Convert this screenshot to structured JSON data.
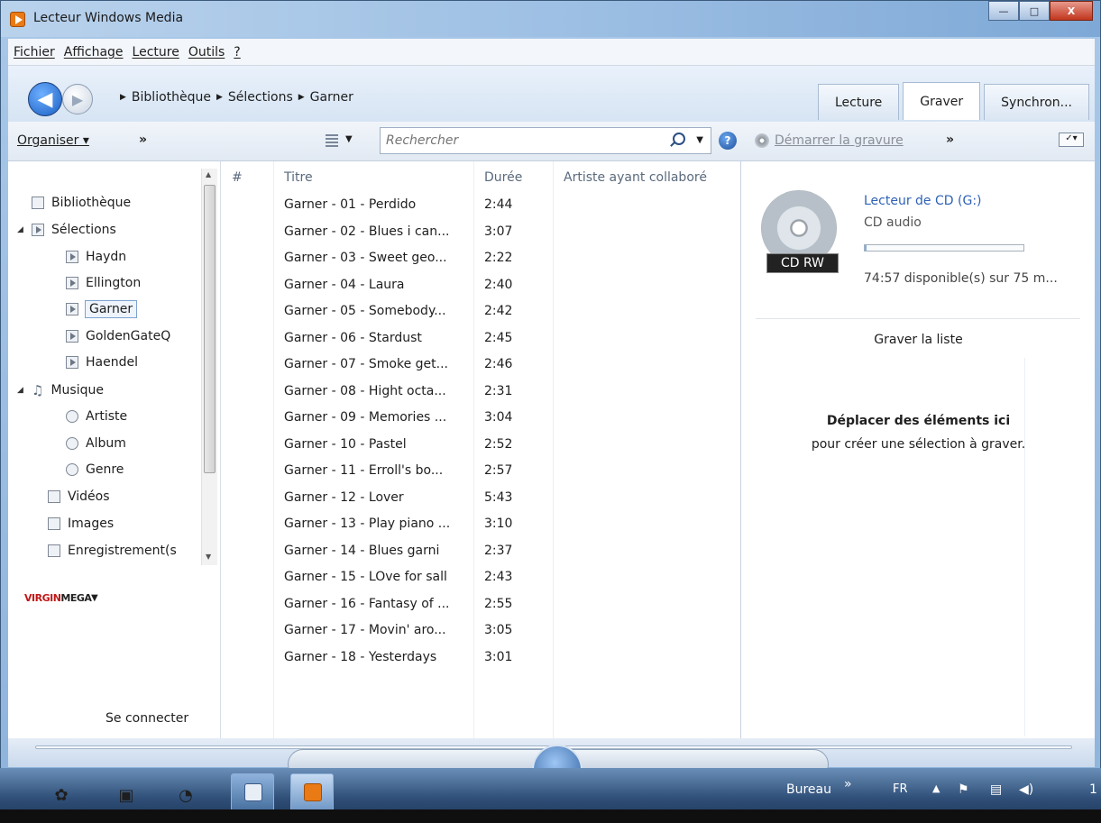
{
  "window": {
    "title": "Lecteur Windows Media",
    "minimize": "—",
    "maximize": "□",
    "close": "X"
  },
  "menu": [
    "Fichier",
    "Affichage",
    "Lecture",
    "Outils",
    "?"
  ],
  "breadcrumb": [
    "Bibliothèque",
    "Sélections",
    "Garner"
  ],
  "tabs": [
    {
      "label": "Lecture",
      "active": false
    },
    {
      "label": "Graver",
      "active": true
    },
    {
      "label": "Synchron...",
      "active": false
    }
  ],
  "toolbar": {
    "organize": "Organiser",
    "more": "»",
    "search_placeholder": "Rechercher",
    "help": "?"
  },
  "burn_toolbar": {
    "start": "Démarrer la gravure",
    "more": "»"
  },
  "nav": {
    "items": [
      {
        "label": "Bibliothèque",
        "icon": "library-icon",
        "level": 0
      },
      {
        "label": "Sélections",
        "icon": "playlist-icon",
        "level": 0,
        "expanded": true
      },
      {
        "label": "Haydn",
        "icon": "playlist-icon",
        "level": 1
      },
      {
        "label": "Ellington",
        "icon": "playlist-icon",
        "level": 1
      },
      {
        "label": "Garner",
        "icon": "playlist-icon",
        "level": 1,
        "selected": true
      },
      {
        "label": "GoldenGateQ",
        "icon": "playlist-icon",
        "level": 1
      },
      {
        "label": "Haendel",
        "icon": "playlist-icon",
        "level": 1
      },
      {
        "label": "Musique",
        "icon": "music-icon",
        "level": 0,
        "expanded": true
      },
      {
        "label": "Artiste",
        "icon": "artist-icon",
        "level": 1
      },
      {
        "label": "Album",
        "icon": "album-icon",
        "level": 1
      },
      {
        "label": "Genre",
        "icon": "genre-icon",
        "level": 1
      },
      {
        "label": "Vidéos",
        "icon": "video-icon",
        "level": 0
      },
      {
        "label": "Images",
        "icon": "images-icon",
        "level": 0
      },
      {
        "label": "Enregistrement(s",
        "icon": "recorded-tv-icon",
        "level": 0
      }
    ],
    "store": {
      "brand": "VIRGIN",
      "brand_suffix": "MEGA"
    },
    "connect": "Se connecter"
  },
  "list": {
    "columns": [
      "#",
      "Titre",
      "Durée",
      "Artiste ayant collaboré"
    ],
    "rows": [
      {
        "title": "Garner - 01 - Perdido",
        "duration": "2:44"
      },
      {
        "title": "Garner - 02 - Blues i can...",
        "duration": "3:07"
      },
      {
        "title": "Garner - 03 - Sweet geo...",
        "duration": "2:22"
      },
      {
        "title": "Garner - 04 - Laura",
        "duration": "2:40"
      },
      {
        "title": "Garner - 05 - Somebody...",
        "duration": "2:42"
      },
      {
        "title": "Garner - 06 - Stardust",
        "duration": "2:45"
      },
      {
        "title": "Garner - 07 - Smoke get...",
        "duration": "2:46"
      },
      {
        "title": "Garner - 08 - Hight octa...",
        "duration": "2:31"
      },
      {
        "title": "Garner - 09 - Memories ...",
        "duration": "3:04"
      },
      {
        "title": "Garner - 10 - Pastel",
        "duration": "2:52"
      },
      {
        "title": "Garner - 11 - Erroll's bo...",
        "duration": "2:57"
      },
      {
        "title": "Garner - 12 - Lover",
        "duration": "5:43"
      },
      {
        "title": "Garner - 13 - Play piano ...",
        "duration": "3:10"
      },
      {
        "title": "Garner - 14 - Blues garni",
        "duration": "2:37"
      },
      {
        "title": "Garner - 15 - LOve for sall",
        "duration": "2:43"
      },
      {
        "title": "Garner - 16 - Fantasy of ...",
        "duration": "2:55"
      },
      {
        "title": "Garner - 17 - Movin' aro...",
        "duration": "3:05"
      },
      {
        "title": "Garner - 18 - Yesterdays",
        "duration": "3:01"
      }
    ]
  },
  "burn": {
    "disc_badge": "CD RW",
    "drive_name": "Lecteur de CD (G:)",
    "drive_type": "CD audio",
    "used_fraction": 0.01,
    "free_text": "74:57 disponible(s) sur 75 m...",
    "list_title": "Graver la liste",
    "drop_title": "Déplacer des éléments ici",
    "drop_sub": "pour créer une sélection à graver."
  },
  "taskbar": {
    "toolbar_label": "Bureau",
    "more": "»",
    "lang": "FR",
    "clock_partial": "1"
  }
}
